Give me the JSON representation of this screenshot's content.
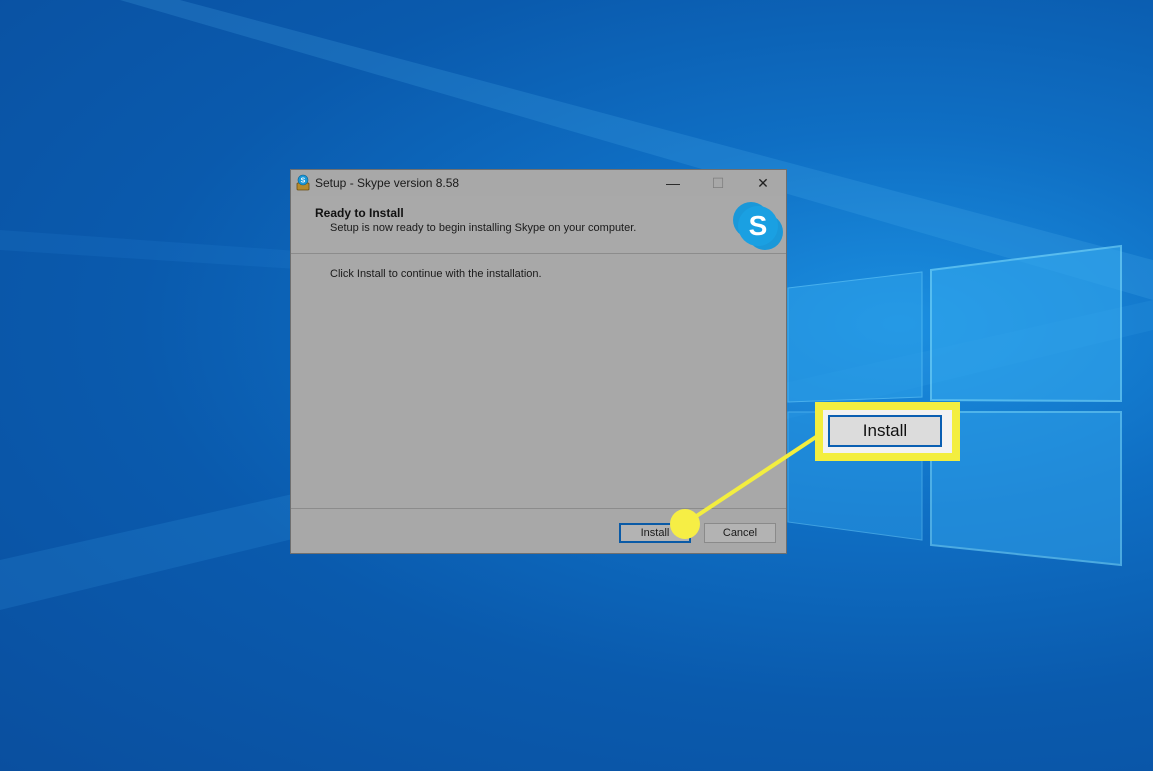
{
  "window": {
    "title": "Setup - Skype version 8.58",
    "minimize_glyph": "—",
    "maximize_glyph": "☐",
    "close_glyph": "✕"
  },
  "header": {
    "title": "Ready to Install",
    "subtitle": "Setup is now ready to begin installing Skype on your computer."
  },
  "body": {
    "message": "Click Install to continue with the installation."
  },
  "buttons": {
    "install_label": "Install",
    "cancel_label": "Cancel"
  },
  "callout": {
    "label": "Install",
    "color": "#f3ee3f"
  },
  "icons": {
    "app": "skype-setup-icon",
    "brand": "skype-logo-icon"
  },
  "colors": {
    "desktop_blue": "#0f6fc4",
    "skype_blue": "#1a98d9",
    "focus_border": "#0a5aa6"
  }
}
